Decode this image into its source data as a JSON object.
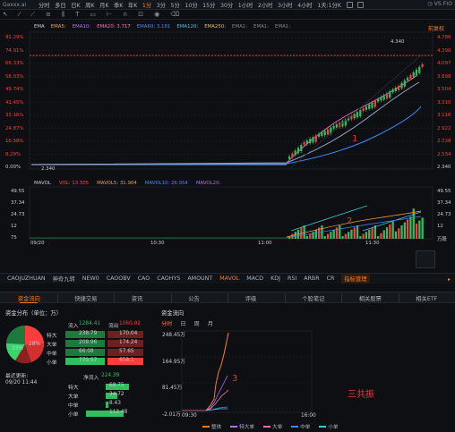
{
  "topbar": {
    "stock": "Gaxxx.ai",
    "periods": [
      "分时",
      "多日",
      "日K",
      "周K",
      "月K",
      "季K",
      "年K",
      "1分",
      "3分",
      "5分",
      "10分",
      "15分",
      "30分",
      "1小时",
      "2小时",
      "3小时",
      "4小时",
      "1天:1分K"
    ],
    "active_index": 7,
    "right_text": "◷ VS FIO"
  },
  "main_chart": {
    "ema_legend": [
      {
        "label": "EMA",
        "color": "#c9cdd3"
      },
      {
        "label": "EMA5:",
        "color": "#ff9a40"
      },
      {
        "label": "EMA10:",
        "color": "#b26cff"
      },
      {
        "label": "EMA20: 3.717",
        "color": "#ff6ac1"
      },
      {
        "label": "EMA60: 3.181",
        "color": "#3a8bff"
      },
      {
        "label": "EMA120:",
        "color": "#42c4d4"
      },
      {
        "label": "EMA250:",
        "color": "#e8c14a"
      },
      {
        "label": "EMA1:",
        "color": "#888888"
      },
      {
        "label": "EMA1:",
        "color": "#888888"
      },
      {
        "label": "EMA1:",
        "color": "#888888"
      }
    ],
    "adjust_label": "前复权",
    "left_pct_labels": [
      "91.29%",
      "74.91%",
      "66.33%",
      "58.03%",
      "49.74%",
      "41.45%",
      "33.16%",
      "24.87%",
      "16.58%",
      "8.29%",
      "0.00%"
    ],
    "right_price_labels": [
      "4.780",
      "4.390",
      "4.097",
      "3.898",
      "3.504",
      "3.310",
      "3.116",
      "2.922",
      "2.728",
      "2.534",
      "2.340"
    ],
    "current_price": "4.340",
    "current_price_right": "4.340",
    "low_price": "2.340",
    "annotation_1": "1"
  },
  "volume_chart": {
    "legend": [
      {
        "label": "MAVOL",
        "color": "#c9cdd3"
      },
      {
        "label": "VOL: 13.305",
        "color": "#ff4a4a"
      },
      {
        "label": "MAVOL5: 31.904",
        "color": "#ff9a40"
      },
      {
        "label": "MAVOL10: 26.954",
        "color": "#3a8bff"
      },
      {
        "label": "MAVOL20:",
        "color": "#b26cff"
      }
    ],
    "y_labels_left": [
      "49.55",
      "37.34",
      "24.73",
      "12",
      "75"
    ],
    "y_labels_right": [
      "49.55",
      "37.34",
      "24.73",
      "12",
      "万股"
    ],
    "annotation_2": "2",
    "x_labels": [
      "09/20",
      "10:30",
      "11:00",
      "11:30"
    ]
  },
  "indicator_tabs": [
    "CAOJUZHUAN",
    "神奇九转",
    "NEW0",
    "CAOOBV",
    "CAO",
    "CAOHYS",
    "AMOUNT",
    "MAVOL",
    "MACD",
    "KDJ",
    "RSI",
    "ARBR",
    "CR",
    "指标管理"
  ],
  "indicator_active": 7,
  "panel_tabs": [
    "资金流向",
    "快捷交易",
    "资讯",
    "公告",
    "评级",
    "个股笔记",
    "相关股票",
    "相关ETF"
  ],
  "panel_active": 0,
  "fund_dist": {
    "title": "资金分布（单位：万）",
    "in_label": "流入",
    "in_total": "1284.41",
    "out_label": "流出",
    "out_total": "1060.02",
    "rows": [
      {
        "name": "特大",
        "in": "238.79",
        "out": "170.04"
      },
      {
        "name": "大单",
        "in": "208.96",
        "out": "174.24"
      },
      {
        "name": "中单",
        "in": "66.08",
        "out": "57.65"
      },
      {
        "name": "小单",
        "in": "770.57",
        "out": "658.1"
      }
    ],
    "pie_labels": [
      "33%",
      "28%"
    ],
    "net_label": "净流入",
    "net_total": "224.39",
    "net_rows": [
      {
        "name": "特大",
        "value": "68.75"
      },
      {
        "name": "大单",
        "value": "34.72"
      },
      {
        "name": "中单",
        "value": "8.43"
      },
      {
        "name": "小单",
        "value": "112.48"
      }
    ],
    "update_label": "最近更新:",
    "update_time": "09/20 11:44"
  },
  "fund_flow": {
    "title": "资金流向",
    "tabs": [
      "分时",
      "日",
      "周",
      "月"
    ],
    "y_labels": [
      "248.45万",
      "164.95万",
      "81.45万",
      "-2.01万"
    ],
    "x_labels": [
      "09:30",
      "16:00"
    ],
    "annotation_3": "3",
    "legend": [
      {
        "label": "整体",
        "color": "#ff7b1a"
      },
      {
        "label": "特大单",
        "color": "#b26cff"
      },
      {
        "label": "大单",
        "color": "#ff6ac1"
      },
      {
        "label": "中单",
        "color": "#3a8bff"
      },
      {
        "label": "小单",
        "color": "#42c4d4"
      }
    ]
  },
  "note_text": "三共振"
}
